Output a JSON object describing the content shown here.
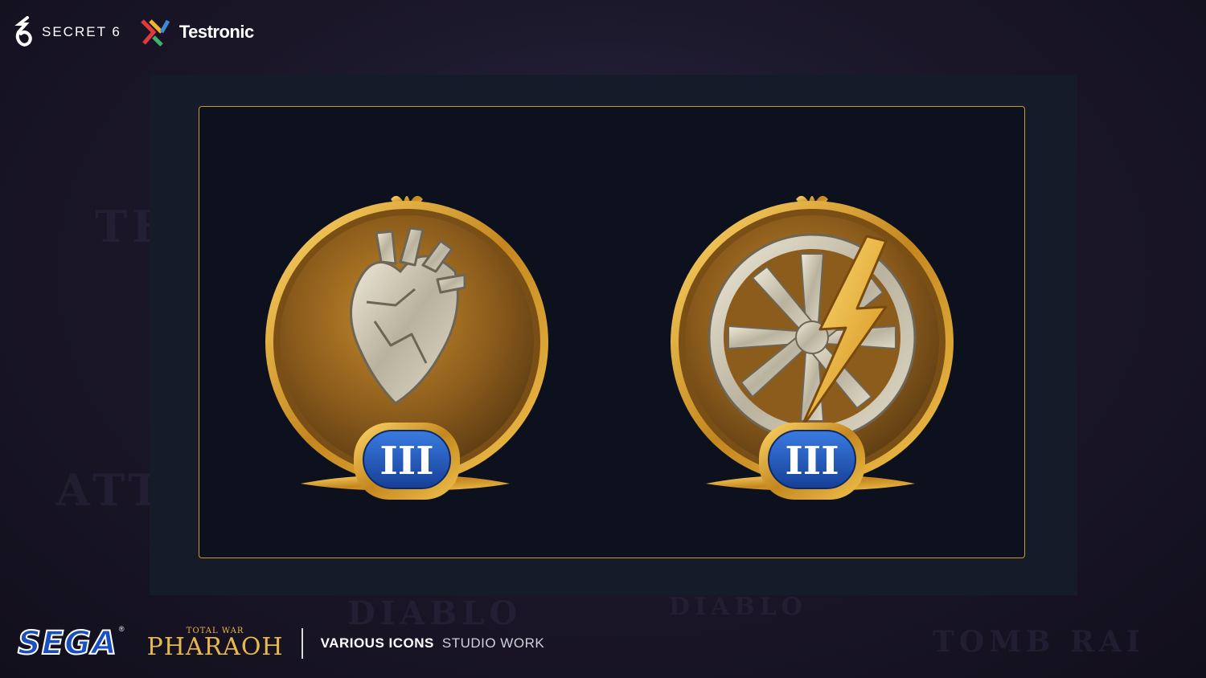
{
  "header": {
    "brand_secret6": "SECRET 6",
    "brand_testronic": "Testronic"
  },
  "background_words": [
    "THE",
    "ATTL",
    "DIABLO",
    "DIABLO",
    "TOMB RAI"
  ],
  "showcase": {
    "icons": [
      {
        "name": "heart-medal",
        "tier": "III"
      },
      {
        "name": "wheel-lightning-medal",
        "tier": "III"
      }
    ]
  },
  "footer": {
    "publisher": "SEGA",
    "registered": "®",
    "game_subtitle": "TOTAL WAR",
    "game_title": "PHARAOH",
    "project_title": "VARIOUS ICONS",
    "project_subtitle": "STUDIO WORK"
  },
  "colors": {
    "gold": "#c69a2c",
    "frame_bg": "#0d111d",
    "panel_bg": "#151b28",
    "tier_blue": "#1d4fb5"
  }
}
